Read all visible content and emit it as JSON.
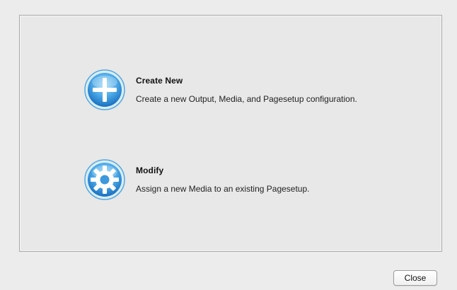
{
  "options": [
    {
      "icon": "plus-icon",
      "title": "Create New",
      "description": "Create a new Output, Media, and Pagesetup configuration."
    },
    {
      "icon": "gear-icon",
      "title": "Modify",
      "description": "Assign a new Media to an existing Pagesetup."
    }
  ],
  "footer": {
    "close_label": "Close"
  },
  "colors": {
    "icon_blue_light": "#7cc8f2",
    "icon_blue_dark": "#1f78c8",
    "window_bg": "#ececec",
    "panel_border": "#a9a9a9"
  }
}
